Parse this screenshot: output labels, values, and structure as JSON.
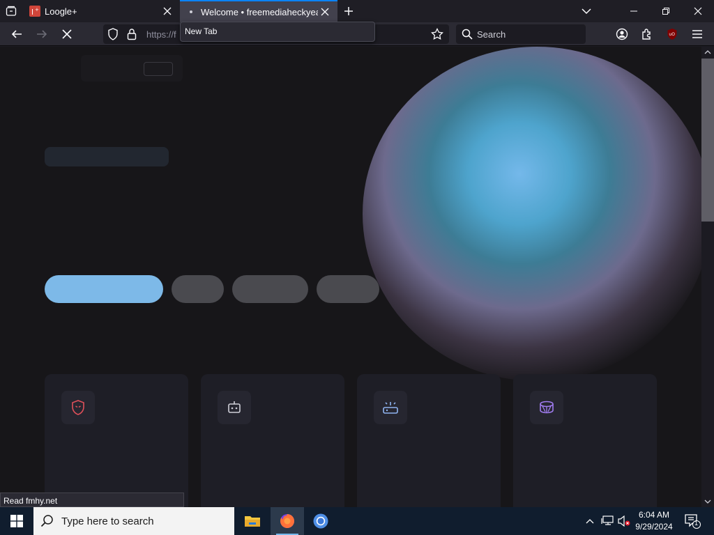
{
  "tabs": [
    {
      "title": "Loogle+",
      "active": false
    },
    {
      "title": "Welcome • freemediaheckyeah",
      "active": true
    }
  ],
  "tooltip": "New Tab",
  "navbar": {
    "url": "https://f",
    "search_placeholder": "Search"
  },
  "status_text": "Read fmhy.net",
  "taskbar": {
    "search_placeholder": "Type here to search",
    "time": "6:04 AM",
    "date": "9/29/2024",
    "notification_count": "1"
  },
  "colors": {
    "accent": "#0a84ff",
    "primary_pill": "#7db9e8",
    "taskbar": "#101d2e"
  },
  "icons": [
    "tab-list-icon",
    "close-icon",
    "plus-icon",
    "chevron-down-icon",
    "minimize-icon",
    "restore-icon",
    "back-icon",
    "forward-icon",
    "stop-icon",
    "shield-icon",
    "lock-icon",
    "star-icon",
    "search-icon",
    "account-icon",
    "extensions-icon",
    "ublock-icon",
    "menu-icon",
    "windows-icon",
    "file-explorer-icon",
    "firefox-icon",
    "chromium-icon",
    "chevron-up-icon",
    "network-icon",
    "volume-muted-icon",
    "notification-icon"
  ]
}
